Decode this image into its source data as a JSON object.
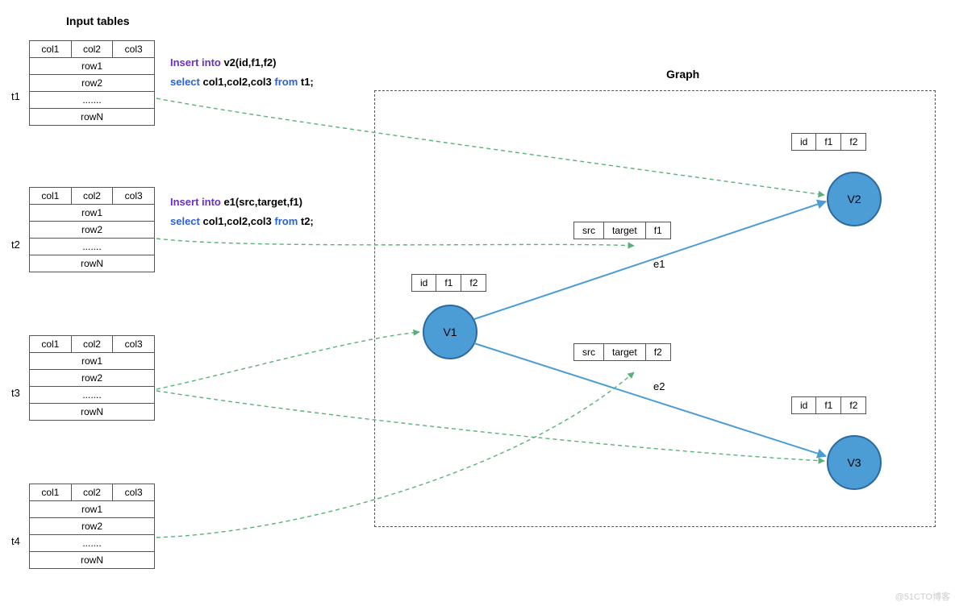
{
  "titles": {
    "input": "Input tables",
    "graph": "Graph"
  },
  "tables": {
    "t1": {
      "label": "t1",
      "cols": [
        "col1",
        "col2",
        "col3"
      ],
      "rows": [
        "row1",
        "row2",
        ".......",
        "rowN"
      ]
    },
    "t2": {
      "label": "t2",
      "cols": [
        "col1",
        "col2",
        "col3"
      ],
      "rows": [
        "row1",
        "row2",
        ".......",
        "rowN"
      ]
    },
    "t3": {
      "label": "t3",
      "cols": [
        "col1",
        "col2",
        "col3"
      ],
      "rows": [
        "row1",
        "row2",
        ".......",
        "rowN"
      ]
    },
    "t4": {
      "label": "t4",
      "cols": [
        "col1",
        "col2",
        "col3"
      ],
      "rows": [
        "row1",
        "row2",
        ".......",
        "rowN"
      ]
    }
  },
  "sql": {
    "l1a": "Insert into ",
    "l1b": "v2(id,f1,f2)",
    "l2a": "select ",
    "l2b": "col1,col2,col3 ",
    "l2c": "from ",
    "l2d": "t1;",
    "l3a": "Insert into ",
    "l3b": "e1(src,target,f1)",
    "l4a": "select ",
    "l4b": "col1,col2,col3 ",
    "l4c": "from ",
    "l4d": "t2;"
  },
  "graph": {
    "v1": {
      "name": "V1",
      "fields": [
        "id",
        "f1",
        "f2"
      ]
    },
    "v2": {
      "name": "V2",
      "fields": [
        "id",
        "f1",
        "f2"
      ]
    },
    "v3": {
      "name": "V3",
      "fields": [
        "id",
        "f1",
        "f2"
      ]
    },
    "e1": {
      "name": "e1",
      "fields": [
        "src",
        "target",
        "f1"
      ]
    },
    "e2": {
      "name": "e2",
      "fields": [
        "src",
        "target",
        "f2"
      ]
    }
  },
  "watermark": "@51CTO博客"
}
